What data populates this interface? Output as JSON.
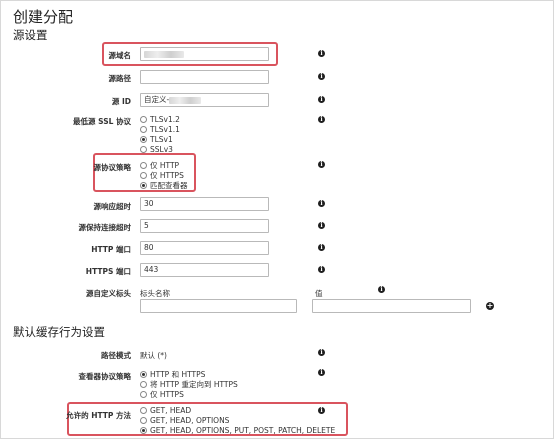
{
  "page_title": "创建分配",
  "origin_section": {
    "title": "源设置",
    "domain_label": "源域名",
    "path_label": "源路径",
    "path_value": "",
    "id_label": "源 ID",
    "id_value": "自定义-",
    "ssl_label": "最低源 SSL 协议",
    "ssl_options": [
      "TLSv1.2",
      "TLSv1.1",
      "TLSv1",
      "SSLv3"
    ],
    "ssl_selected": "TLSv1",
    "protocol_label": "源协议策略",
    "protocol_options": [
      "仅 HTTP",
      "仅 HTTPS",
      "匹配查看器"
    ],
    "protocol_selected": "匹配查看器",
    "response_timeout_label": "源响应超时",
    "response_timeout_value": "30",
    "keepalive_label": "源保持连接超时",
    "keepalive_value": "5",
    "http_port_label": "HTTP 端口",
    "http_port_value": "80",
    "https_port_label": "HTTPS 端口",
    "https_port_value": "443",
    "custom_header_label": "源自定义标头",
    "header_name_col": "标头名称",
    "header_value_col": "值",
    "header_name_value": "",
    "header_value_value": ""
  },
  "cache_section": {
    "title": "默认缓存行为设置",
    "path_pattern_label": "路径模式",
    "path_pattern_value": "默认 (*)",
    "viewer_protocol_label": "查看器协议策略",
    "viewer_protocol_options": [
      "HTTP 和 HTTPS",
      "将 HTTP 重定向到 HTTPS",
      "仅 HTTPS"
    ],
    "viewer_protocol_selected": "HTTP 和 HTTPS",
    "methods_label": "允许的 HTTP 方法",
    "methods_options": [
      "GET, HEAD",
      "GET, HEAD, OPTIONS",
      "GET, HEAD, OPTIONS, PUT, POST, PATCH, DELETE"
    ],
    "methods_selected": "GET, HEAD, OPTIONS, PUT, POST, PATCH, DELETE"
  },
  "icons": {
    "info": "info-icon",
    "add": "plus-circle-icon"
  },
  "colors": {
    "highlight": "#d9545e"
  }
}
